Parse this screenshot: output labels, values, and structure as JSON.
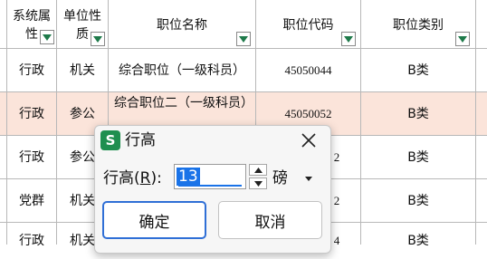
{
  "columns": {
    "system": "系统属性",
    "unit": "单位性质",
    "name": "职位名称",
    "code": "职位代码",
    "category": "职位类别"
  },
  "rows": [
    {
      "system": "行政",
      "unit": "机关",
      "name": "综合职位（一级科员）",
      "code": "45050044",
      "category": "B类"
    },
    {
      "system": "行政",
      "unit": "参公",
      "name": "综合职位二（一级科员）",
      "code": "45050052",
      "category": "B类"
    },
    {
      "system": "行政",
      "unit": "参公",
      "name": "",
      "code": "2",
      "category": "B类"
    },
    {
      "system": "党群",
      "unit": "机关",
      "name": "",
      "code": "2",
      "category": "B类"
    },
    {
      "system": "行政",
      "unit": "机关",
      "name": "",
      "code": "4",
      "category": "B类"
    }
  ],
  "dialog": {
    "app_badge": "S",
    "title": "行高",
    "label_prefix": "行高(",
    "label_key": "R",
    "label_suffix": "):",
    "value": "13",
    "unit": "磅",
    "ok_label": "确定",
    "cancel_label": "取消"
  },
  "colors": {
    "highlight_row": "#fbe4da",
    "accent": "#1a73e8",
    "filter_arrow": "#1f7a4a",
    "app_logo": "#1f8f4f"
  }
}
